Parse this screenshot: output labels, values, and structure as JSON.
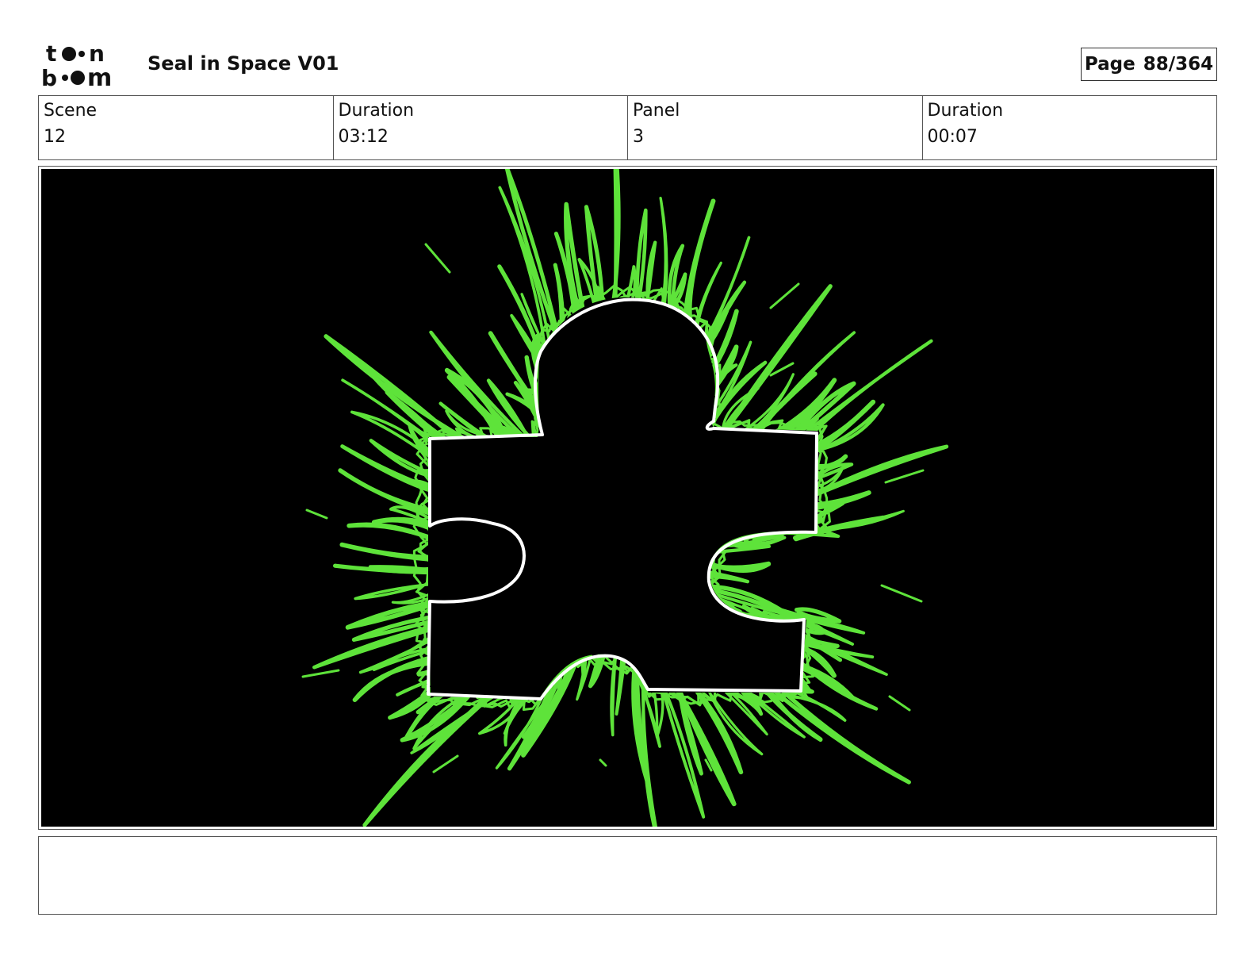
{
  "header": {
    "logo_text": "toonboom",
    "project_title": "Seal in Space V01",
    "page_label": "Page",
    "page_number": "88/364"
  },
  "info": {
    "scene_label": "Scene",
    "scene_value": "12",
    "scene_duration_label": "Duration",
    "scene_duration_value": "03:12",
    "panel_label": "Panel",
    "panel_value": "3",
    "panel_duration_label": "Duration",
    "panel_duration_value": "00:07"
  },
  "panel": {
    "background_color": "#000000",
    "outline_color": "#ffffff",
    "glow_color": "#5ee33a",
    "subject": "puzzle-piece"
  },
  "notes": {
    "text": ""
  }
}
